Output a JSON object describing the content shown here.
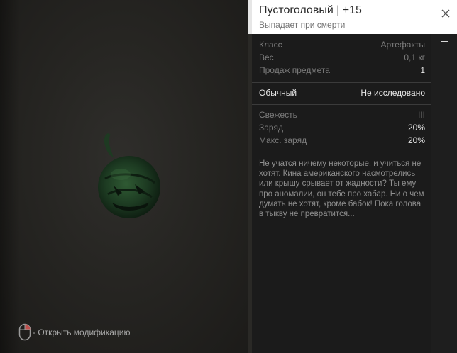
{
  "hint": {
    "label": "- Открыть модификацию",
    "icon": "mouse-right-click-icon"
  },
  "item": {
    "title": "Пустоголовый | +15",
    "subtitle": "Выпадает при смерти",
    "close_icon": "close-icon"
  },
  "stats": [
    {
      "label": "Класс",
      "value": "Артефакты"
    },
    {
      "label": "Вес",
      "value": "0,1 кг"
    },
    {
      "label": "Продаж предмета",
      "value": "1"
    }
  ],
  "rarity": {
    "label": "Обычный",
    "value": "Не исследовано"
  },
  "props": [
    {
      "label": "Свежесть",
      "value": "III"
    },
    {
      "label": "Заряд",
      "value": "20%"
    },
    {
      "label": "Макс. заряд",
      "value": "20%"
    }
  ],
  "description": "Не учатся ничему некоторые, и учиться не хотят. Кина американского насмотрелись или крышу срывает от жадности? Ты ему про аномалии, он тебе про хабар. Ни о чем думать не хотят, кроме бабок! Пока голова в тыкву не превратится...",
  "colors": {
    "header_bg": "#ffffff",
    "panel_bg": "#1b1b1b",
    "accent_mouse": "#c0504d"
  }
}
